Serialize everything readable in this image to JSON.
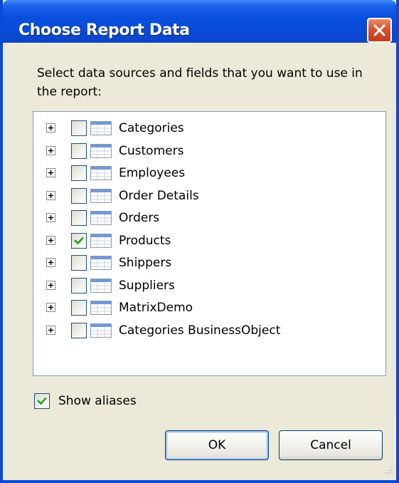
{
  "window": {
    "title": "Choose Report Data",
    "close_icon": "close-icon",
    "colors": {
      "titlebar": "#0a50dd",
      "close": "#d9532c",
      "face": "#ece9d8",
      "check": "#21a121"
    }
  },
  "instructions": "Select data sources and fields that you want to use in the report:",
  "tree": {
    "items": [
      {
        "label": "Categories",
        "checked": false
      },
      {
        "label": "Customers",
        "checked": false
      },
      {
        "label": "Employees",
        "checked": false
      },
      {
        "label": "Order Details",
        "checked": false
      },
      {
        "label": "Orders",
        "checked": false
      },
      {
        "label": "Products",
        "checked": true
      },
      {
        "label": "Shippers",
        "checked": false
      },
      {
        "label": "Suppliers",
        "checked": false
      },
      {
        "label": "MatrixDemo",
        "checked": false
      },
      {
        "label": "Categories BusinessObject",
        "checked": false
      }
    ],
    "item_icon": "table-icon",
    "expander_icon": "plus-icon"
  },
  "show_aliases": {
    "label": "Show aliases",
    "checked": true
  },
  "buttons": {
    "ok": "OK",
    "cancel": "Cancel"
  }
}
